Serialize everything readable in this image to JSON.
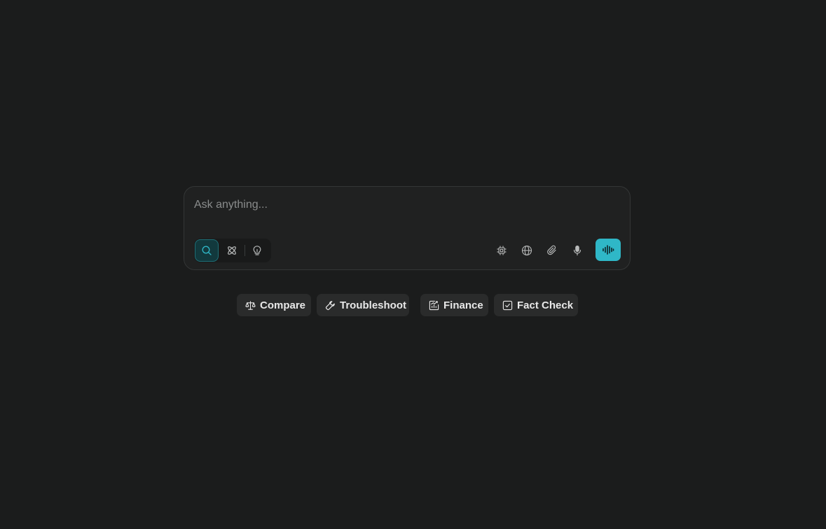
{
  "composer": {
    "placeholder": "Ask anything...",
    "value": "",
    "modes": [
      {
        "name": "search",
        "icon": "search-icon",
        "active": true
      },
      {
        "name": "research",
        "icon": "atom-icon",
        "active": false
      },
      {
        "name": "labs",
        "icon": "lightbulb-icon",
        "active": false
      }
    ],
    "tools": [
      {
        "name": "model",
        "icon": "chip-icon"
      },
      {
        "name": "sources",
        "icon": "globe-icon"
      },
      {
        "name": "attach",
        "icon": "paperclip-icon"
      },
      {
        "name": "dictation",
        "icon": "microphone-icon"
      }
    ],
    "voice": {
      "icon": "waveform-icon"
    }
  },
  "suggestions": [
    {
      "label": "Compare",
      "icon": "scale-icon"
    },
    {
      "label": "Troubleshoot",
      "icon": "wrench-icon"
    },
    {
      "label": "Finance",
      "icon": "chart-icon"
    },
    {
      "label": "Fact Check",
      "icon": "checkbox-icon"
    }
  ],
  "colors": {
    "background": "#1b1c1c",
    "composer": "#202121",
    "accent": "#2fb7c7",
    "active_mode": "#12393d",
    "chip": "#2a2b2b"
  }
}
